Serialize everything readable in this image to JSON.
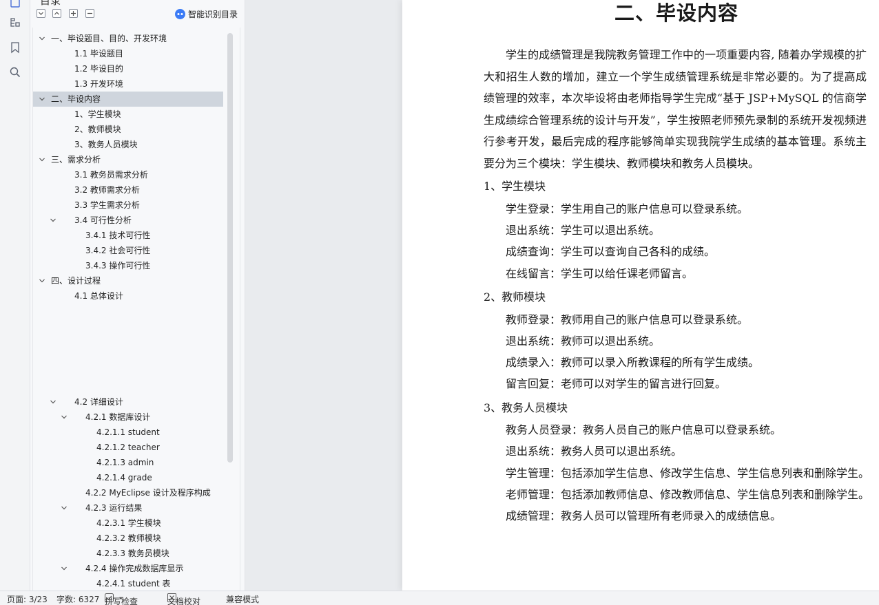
{
  "outline": {
    "title": "目录",
    "smart_toc_label": "智能识别目录",
    "items": [
      {
        "label": "一、毕设题目、目的、开发环境",
        "level": 0,
        "expanded": true
      },
      {
        "label": "1.1 毕设题目",
        "level": 1
      },
      {
        "label": "1.2 毕设目的",
        "level": 1
      },
      {
        "label": "1.3 开发环境",
        "level": 1
      },
      {
        "label": "二、毕设内容",
        "level": 0,
        "expanded": true,
        "selected": true
      },
      {
        "label": "1、学生模块",
        "level": 1
      },
      {
        "label": "2、教师模块",
        "level": 1
      },
      {
        "label": "3、教务人员模块",
        "level": 1
      },
      {
        "label": "三、需求分析",
        "level": 0,
        "expanded": true
      },
      {
        "label": "3.1 教务员需求分析",
        "level": 1
      },
      {
        "label": "3.2 教师需求分析",
        "level": 1
      },
      {
        "label": "3.3 学生需求分析",
        "level": 1
      },
      {
        "label": "3.4 可行性分析",
        "level": 1,
        "expanded": true
      },
      {
        "label": "3.4.1 技术可行性",
        "level": 2
      },
      {
        "label": "3.4.2 社会可行性",
        "level": 2
      },
      {
        "label": "3.4.3 操作可行性",
        "level": 2
      },
      {
        "label": "四、设计过程",
        "level": 0,
        "expanded": true
      },
      {
        "label": "4.1 总体设计",
        "level": 1
      },
      {
        "label": "4.2 详细设计",
        "level": 1,
        "expanded": true
      },
      {
        "label": "4.2.1 数据库设计",
        "level": 2,
        "expanded": true
      },
      {
        "label": "4.2.1.1 student",
        "level": 3
      },
      {
        "label": "4.2.1.2 teacher",
        "level": 3
      },
      {
        "label": "4.2.1.3 admin",
        "level": 3
      },
      {
        "label": "4.2.1.4 grade",
        "level": 3
      },
      {
        "label": "4.2.2 MyEclipse 设计及程序构成",
        "level": 2
      },
      {
        "label": "4.2.3 运行结果",
        "level": 2,
        "expanded": true
      },
      {
        "label": "4.2.3.1  学生模块",
        "level": 3
      },
      {
        "label": "4.2.3.2  教师模块",
        "level": 3
      },
      {
        "label": "4.2.3.3  教务员模块",
        "level": 3
      },
      {
        "label": "4.2.4  操作完成数据库显示",
        "level": 2,
        "expanded": true
      },
      {
        "label": "4.2.4.1 student 表",
        "level": 3
      }
    ]
  },
  "document": {
    "title": "二、毕设内容",
    "intro": "学生的成绩管理是我院教务管理工作中的一项重要内容, 随着办学规模的扩大和招生人数的增加，建立一个学生成绩管理系统是非常必要的。为了提高成绩管理的效率，本次毕设将由老师指导学生完成“基于 JSP+MySQL 的信商学生成绩综合管理系统的设计与开发”，学生按照老师预先录制的系统开发视频进行参考开发，最后完成的程序能够简单实现我院学生成绩的基本管理。系统主要分为三个模块：学生模块、教师模块和教务人员模块。",
    "sections": [
      {
        "heading": "1、学生模块",
        "lines": [
          "学生登录：学生用自己的账户信息可以登录系统。",
          "退出系统：学生可以退出系统。",
          "成绩查询：学生可以查询自己各科的成绩。",
          "在线留言：学生可以给任课老师留言。"
        ]
      },
      {
        "heading": "2、教师模块",
        "lines": [
          "教师登录：教师用自己的账户信息可以登录系统。",
          "退出系统：教师可以退出系统。",
          "成绩录入：教师可以录入所教课程的所有学生成绩。",
          "留言回复：老师可以对学生的留言进行回复。"
        ]
      },
      {
        "heading": "3、教务人员模块",
        "lines": [
          "教务人员登录：教务人员自己的账户信息可以登录系统。",
          "退出系统：教务人员可以退出系统。",
          "学生管理：包括添加学生信息、修改学生信息、学生信息列表和删除学生。",
          "老师管理：包括添加教师信息、修改教师信息、学生信息列表和删除学生。",
          "成绩管理：教务人员可以管理所有老师录入的成绩信息。"
        ]
      }
    ]
  },
  "status": {
    "page": "页面: 3/23",
    "words": "字数: 6327",
    "spell_check": "拼写检查",
    "doc_proof": "文档校对",
    "compat_mode": "兼容模式"
  }
}
